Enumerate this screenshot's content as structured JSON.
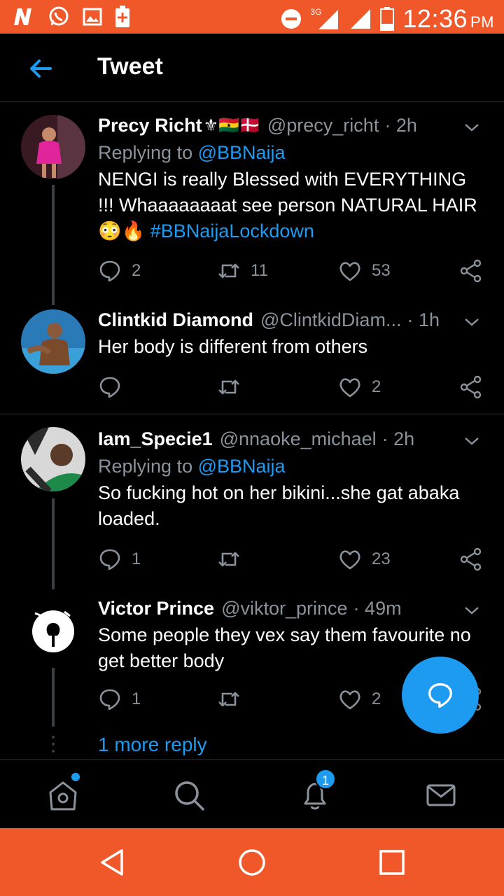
{
  "status_bar": {
    "network_label": "3G",
    "time": "12:36",
    "ampm": "PM",
    "icons": [
      "notification-n-icon",
      "whatsapp-icon",
      "gallery-icon",
      "battery-saver-icon",
      "do-not-disturb-icon",
      "signal-icon",
      "signal-icon",
      "battery-icon"
    ]
  },
  "header": {
    "title": "Tweet",
    "back_icon": "arrow-left-icon"
  },
  "tweets": [
    {
      "name": "Precy Richt",
      "name_emoji": "⚜🇬🇭🇩🇰",
      "handle": "@precy_richt",
      "time": "· 2h",
      "replying_prefix": "Replying to ",
      "replying_to": "@BBNaija",
      "body": "NENGI is really Blessed with EVERYTHING !!! Whaaaaaaaat see person NATURAL HAIR",
      "emoji": "😳🔥",
      "hashtag": "#BBNaijaLockdown",
      "replies": "2",
      "retweets": "11",
      "likes": "53"
    },
    {
      "name": "Clintkid Diamond",
      "handle": "@ClintkidDiam...",
      "time": "· 1h",
      "body": "Her body is different from others",
      "replies": "",
      "retweets": "",
      "likes": "2"
    },
    {
      "name": "Iam_Specie1",
      "handle": "@nnaoke_michael",
      "time": "· 2h",
      "replying_prefix": "Replying to ",
      "replying_to": "@BBNaija",
      "body": "So fucking hot on her bikini...she gat abaka loaded.",
      "replies": "1",
      "retweets": "",
      "likes": "23"
    },
    {
      "name": "Victor Prince",
      "handle": "@viktor_prince",
      "time": "· 49m",
      "body": "Some people they vex say them favourite no get better body",
      "replies": "1",
      "retweets": "",
      "likes": "2"
    }
  ],
  "more_replies": "1 more reply",
  "bottom_nav": {
    "items": [
      "home-icon",
      "search-icon",
      "notifications-icon",
      "messages-icon"
    ],
    "notification_count": "1"
  },
  "colors": {
    "accent": "#1d9bf0",
    "status_bar": "#f0582a",
    "secondary_text": "#8a939c"
  }
}
